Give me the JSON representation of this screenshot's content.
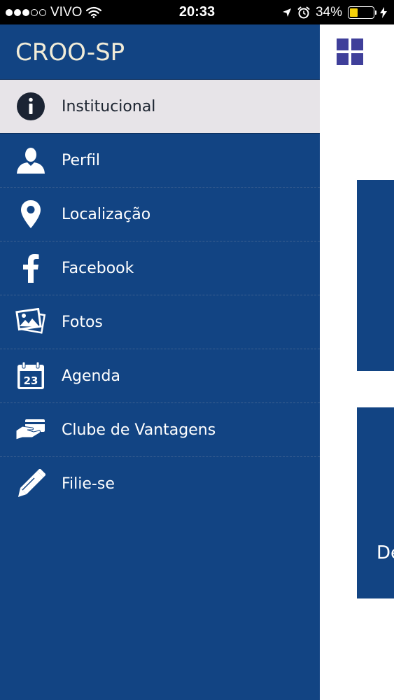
{
  "status_bar": {
    "carrier": "VIVO",
    "time": "20:33",
    "battery": "34%",
    "battery_level": 0.34,
    "signal_bars": 3,
    "signal_total": 5
  },
  "drawer": {
    "title": "CROO-SP",
    "items": [
      {
        "label": "Institucional",
        "icon": "info-icon",
        "active": true
      },
      {
        "label": "Perfil",
        "icon": "user-icon",
        "active": false
      },
      {
        "label": "Localização",
        "icon": "location-pin-icon",
        "active": false
      },
      {
        "label": "Facebook",
        "icon": "facebook-icon",
        "active": false
      },
      {
        "label": "Fotos",
        "icon": "photos-icon",
        "active": false
      },
      {
        "label": "Agenda",
        "icon": "calendar-icon",
        "active": false
      },
      {
        "label": "Clube de Vantagens",
        "icon": "card-hand-icon",
        "active": false
      },
      {
        "label": "Filie-se",
        "icon": "pen-icon",
        "active": false
      }
    ],
    "calendar_day": "23"
  },
  "content": {
    "tile_text": "De"
  },
  "colors": {
    "primary": "#124483",
    "active_bg": "#e7e4e8",
    "grid_icon": "#3f3f9a",
    "title": "#f1ecd8"
  }
}
